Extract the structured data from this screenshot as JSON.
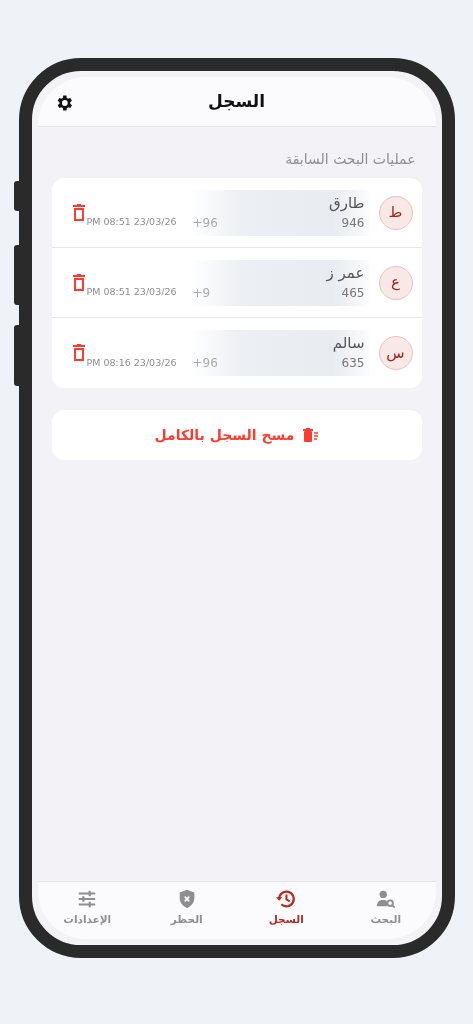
{
  "header": {
    "title": "السجل"
  },
  "section_title": "عمليات البحث السابقة",
  "history": [
    {
      "initial": "ط",
      "name": "طارق",
      "number_end": "946",
      "number_start": "+96",
      "time": "PM 08:51 23/03/26"
    },
    {
      "initial": "ع",
      "name": "عمر ز",
      "number_end": "465",
      "number_start": "+9",
      "time": "PM 08:51 23/03/26"
    },
    {
      "initial": "س",
      "name": "سالم",
      "number_end": "635",
      "number_start": "+96",
      "time": "PM 08:16 23/03/26"
    }
  ],
  "clear_button": "مسح السجل بالكامل",
  "tabs": [
    {
      "kind": "search",
      "label": "البحث",
      "selected": false
    },
    {
      "kind": "history",
      "label": "السجل",
      "selected": true
    },
    {
      "kind": "block",
      "label": "الحظر",
      "selected": false
    },
    {
      "kind": "settings",
      "label": "الإعدادات",
      "selected": false
    }
  ]
}
